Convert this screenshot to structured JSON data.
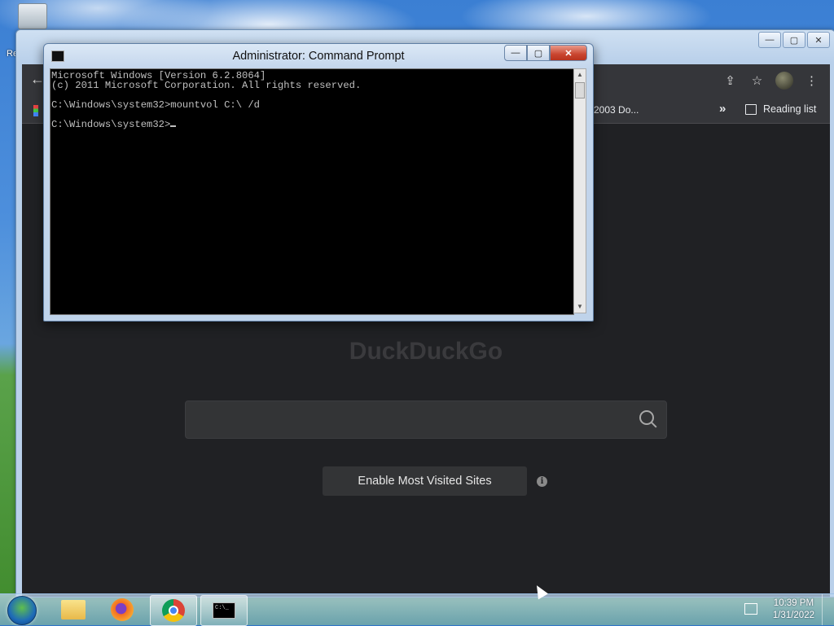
{
  "desktop": {
    "recycle_bin_label": "Re"
  },
  "browser": {
    "window_controls": {
      "minimize": "—",
      "maximize": "▢",
      "close": "✕"
    },
    "bookmarks": {
      "truncated_item": "2003 Do...",
      "more": "»",
      "reading_list": "Reading list"
    },
    "page": {
      "logo_text": "DuckDuckGo",
      "search_placeholder": "",
      "enable_button": "Enable Most Visited Sites",
      "info_icon": "i"
    }
  },
  "cmd": {
    "title": "Administrator: Command Prompt",
    "controls": {
      "minimize": "—",
      "maximize": "▢",
      "close": "✕"
    },
    "lines": [
      "Microsoft Windows [Version 6.2.8064]",
      "(c) 2011 Microsoft Corporation. All rights reserved.",
      "",
      "C:\\Windows\\system32>mountvol C:\\ /d",
      "",
      "C:\\Windows\\system32>"
    ]
  },
  "taskbar": {
    "apps": [
      "file-explorer",
      "firefox",
      "chrome",
      "command-prompt"
    ],
    "cmd_icon_text": "C:\\_",
    "clock_time": "10:39 PM",
    "clock_date": "1/31/2022"
  }
}
